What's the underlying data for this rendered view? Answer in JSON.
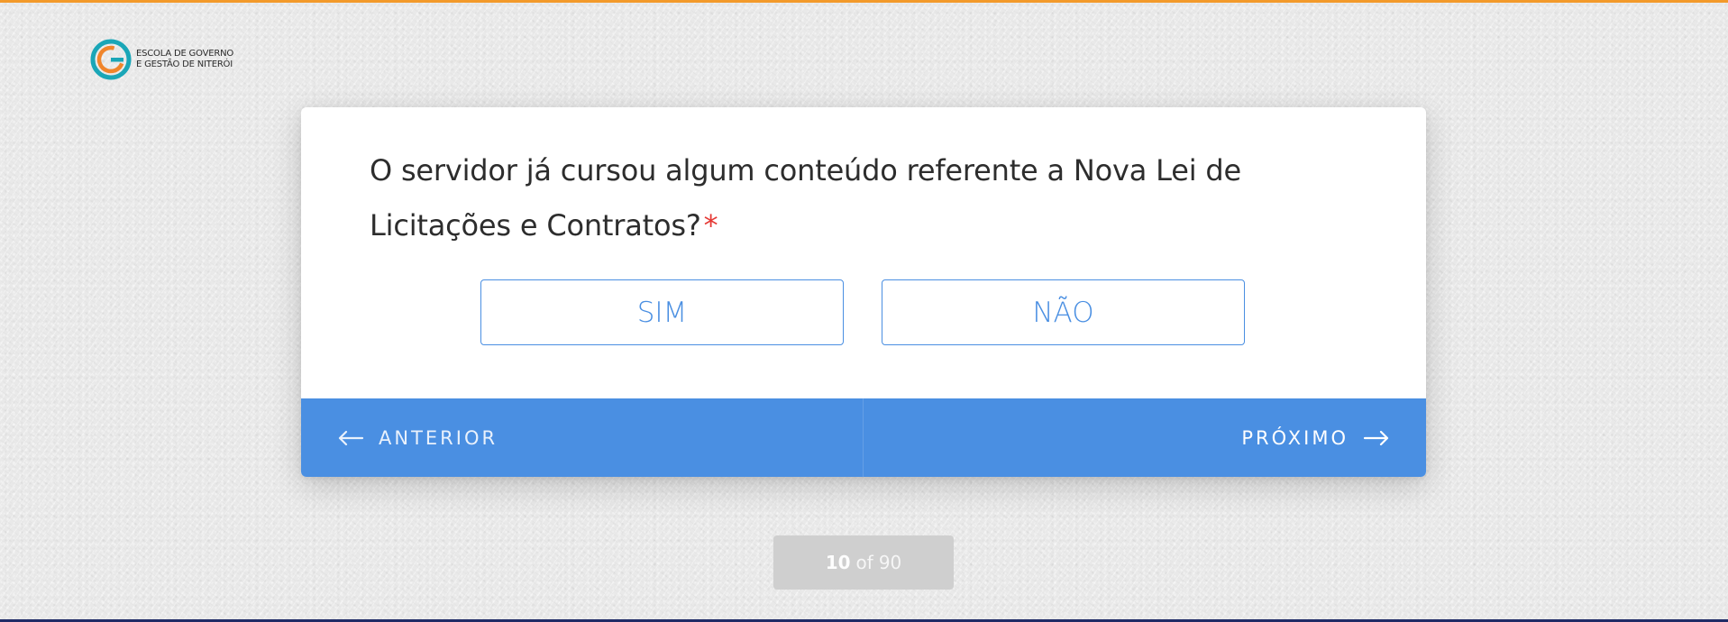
{
  "theme": {
    "accent": "#4a8fe2",
    "required": "#e53935",
    "top_border": "#f39a2b",
    "bottom_border": "#1f2b66",
    "nav_text": "#e9f1fc",
    "counter_bg": "#cfcfcf"
  },
  "logo": {
    "icon": "escola-governo-logo-icon",
    "line1": "ESCOLA DE GOVERNO",
    "line2": "E GESTÃO DE NITERÓI"
  },
  "question": {
    "text": "O servidor já cursou algum conteúdo referente a Nova Lei de Licitações e Contratos?",
    "required_mark": "*"
  },
  "choices": {
    "yes": "SIM",
    "no": "NÃO"
  },
  "navigation": {
    "previous_label": "ANTERIOR",
    "previous_icon": "arrow-left-icon",
    "next_label": "PRÓXIMO",
    "next_icon": "arrow-right-icon"
  },
  "progress": {
    "current": "10",
    "separator": "of",
    "total": "90"
  }
}
